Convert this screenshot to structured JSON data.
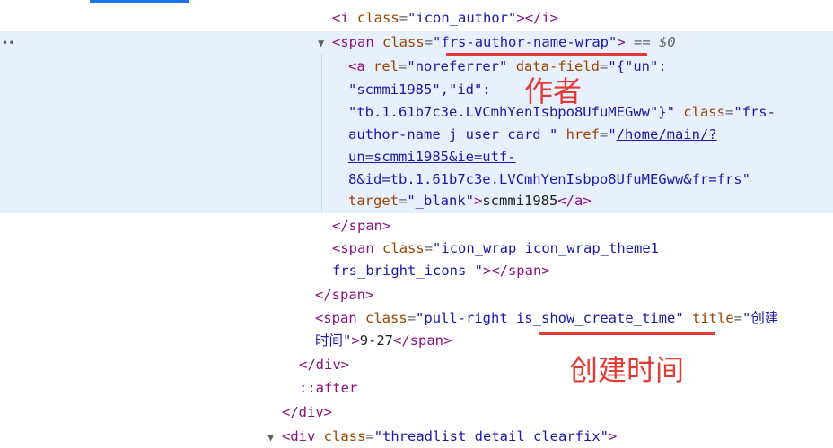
{
  "top_line": {
    "text": "<i class=\"icon_author\"></i>",
    "open_tag": "<i",
    "attr_name": "class",
    "attr_value": "\"icon_author\"",
    "end": "></i>"
  },
  "span_author_wrap": {
    "open_tag": "<span",
    "attr_name": "class",
    "attr_value_q1": "\"",
    "attr_value": "frs-author-name-wrap",
    "attr_value_q2": "\"",
    "close_bracket": ">",
    "eq": "==",
    "selected_marker": "$0"
  },
  "anchor": {
    "line1_tag": "<a",
    "line1_attr1": "rel",
    "line1_val1": "\"noreferrer\"",
    "line1_attr2": "data-field",
    "line1_val2": "\"{\"un\":",
    "line2": "\"scmmi1985\",\"id\":",
    "line3_val": "\"tb.1.61b7c3e.LVCmhYenIsbpo8UfuMEGww\"}\"",
    "line3_attr": "class",
    "line3_val2": "\"frs-",
    "line4_val": "author-name j_user_card \"",
    "line4_attr": "href",
    "line4_q": "\"",
    "line4_link": "/home/main/?",
    "line5_link": "un=scmmi1985&ie=utf-",
    "line6_link": "8&id=tb.1.61b7c3e.LVCmhYenIsbpo8UfuMEGww&fr=frs",
    "line6_q": "\"",
    "line7_attr": "target",
    "line7_val": "\"_blank\"",
    "line7_text": "scmmi1985",
    "line7_close": "</a>"
  },
  "span_close_1": "</span>",
  "icon_wrap": {
    "open_tag": "<span",
    "attr_name": "class",
    "line1_val": "\"icon_wrap  icon_wrap_theme1",
    "line2_val": "frs_bright_icons \"",
    "line2_end": "></span>"
  },
  "span_close_2": "</span>",
  "pull_right": {
    "open_tag": "<span",
    "attr_name": "class",
    "val_q1": "\"pull-right ",
    "val_highlight": "is_show_create_time",
    "val_q2": "\"",
    "title_attr": "title",
    "title_val_part1": "\"创建",
    "title_val_part2": "时间\"",
    "text": "9-27",
    "close": "</span>"
  },
  "div_close_1": "</div>",
  "after_pseudo": "::after",
  "div_close_2": "</div>",
  "threadlist_div": {
    "open_tag": "<div",
    "attr_name": "class",
    "attr_value": "\"threadlist detail clearfix\"",
    "end": ">"
  },
  "annotations": {
    "author_label": "作者",
    "create_time_label": "创建时间",
    "color": "#e53935"
  },
  "colors": {
    "selection_background": "#e8f0fe",
    "tag": "#881280",
    "attribute": "#994500",
    "value": "#1a1aa6"
  }
}
